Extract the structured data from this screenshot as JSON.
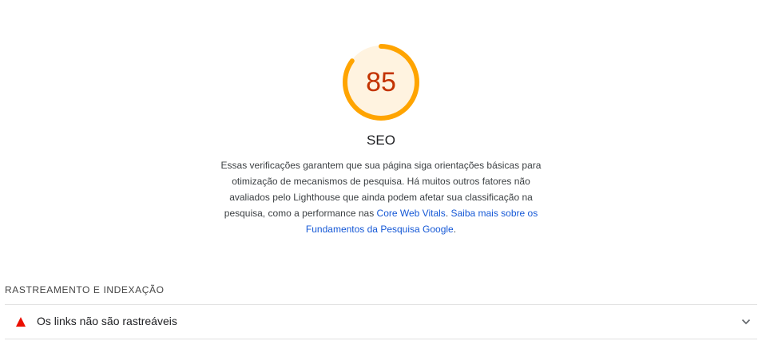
{
  "category": {
    "score": "85",
    "score_fraction": 0.85,
    "title": "SEO",
    "gauge_color": "#ffa400",
    "gauge_bg_color": "#fff3e0",
    "score_text_color": "#c33300",
    "description_text": "Essas verificações garantem que sua página siga orientações básicas para otimização de mecanismos de pesquisa. Há muitos outros fatores não avaliados pelo Lighthouse que ainda podem afetar sua classificação na pesquisa, como a performance nas ",
    "link_cwv": "Core Web Vitals",
    "link_sep": ". ",
    "link_learn_more": "Saiba mais sobre os Fundamentos da Pesquisa Google",
    "description_end": "."
  },
  "group": {
    "title": "RASTREAMENTO E INDEXAÇÃO",
    "audits": [
      {
        "title": "Os links não são rastreáveis",
        "status_icon": "fail-triangle-icon",
        "status_color": "#eb0f00"
      }
    ]
  }
}
